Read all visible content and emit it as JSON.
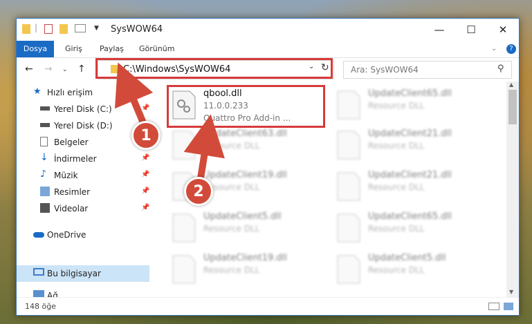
{
  "window": {
    "title": "SysWOW64"
  },
  "ribbon": {
    "tabs": [
      "Dosya",
      "Giriş",
      "Paylaş",
      "Görünüm"
    ]
  },
  "address": {
    "path": "C:\\Windows\\SysWOW64",
    "search_placeholder": "Ara: SysWOW64"
  },
  "sidebar": {
    "items": [
      {
        "label": "Hızlı erişim",
        "icon": "star-icon"
      },
      {
        "label": "Yerel Disk (C:)",
        "icon": "drive-icon",
        "pinned": true
      },
      {
        "label": "Yerel Disk (D:)",
        "icon": "drive-icon",
        "pinned": true
      },
      {
        "label": "Belgeler",
        "icon": "documents-icon",
        "pinned": true
      },
      {
        "label": "İndirmeler",
        "icon": "download-icon",
        "pinned": true
      },
      {
        "label": "Müzik",
        "icon": "music-icon",
        "pinned": true
      },
      {
        "label": "Resimler",
        "icon": "pictures-icon",
        "pinned": true
      },
      {
        "label": "Videolar",
        "icon": "video-icon",
        "pinned": true
      },
      {
        "label": "OneDrive",
        "icon": "cloud-icon"
      },
      {
        "label": "Bu bilgisayar",
        "icon": "computer-icon",
        "selected": true
      },
      {
        "label": "Ağ",
        "icon": "network-icon"
      }
    ]
  },
  "files": {
    "highlighted": {
      "name": "qbool.dll",
      "version": "11.0.0.233",
      "description": "Quattro Pro Add-in ..."
    },
    "left_blurred": [
      {
        "name": "UpdateClient63.dll",
        "desc": "Resource DLL"
      },
      {
        "name": "UpdateClient19.dll",
        "desc": "Resource DLL"
      },
      {
        "name": "UpdateClient5.dll",
        "desc": "Resource DLL"
      },
      {
        "name": "UpdateClient19.dll",
        "desc": "Resource DLL"
      }
    ],
    "right_blurred": [
      {
        "name": "UpdateClient65.dll",
        "desc": "Resource DLL"
      },
      {
        "name": "UpdateClient21.dll",
        "desc": "Resource DLL"
      },
      {
        "name": "UpdateClient21.dll",
        "desc": "Resource DLL"
      },
      {
        "name": "UpdateClient65.dll",
        "desc": "Resource DLL"
      },
      {
        "name": "UpdateClient5.dll",
        "desc": "Resource DLL"
      }
    ]
  },
  "status": {
    "count": "148 öğe"
  },
  "annotations": {
    "step1": "1",
    "step2": "2"
  },
  "colors": {
    "accent": "#1a6bc4",
    "highlight": "#d63a3a",
    "selected": "#cce4f7"
  }
}
